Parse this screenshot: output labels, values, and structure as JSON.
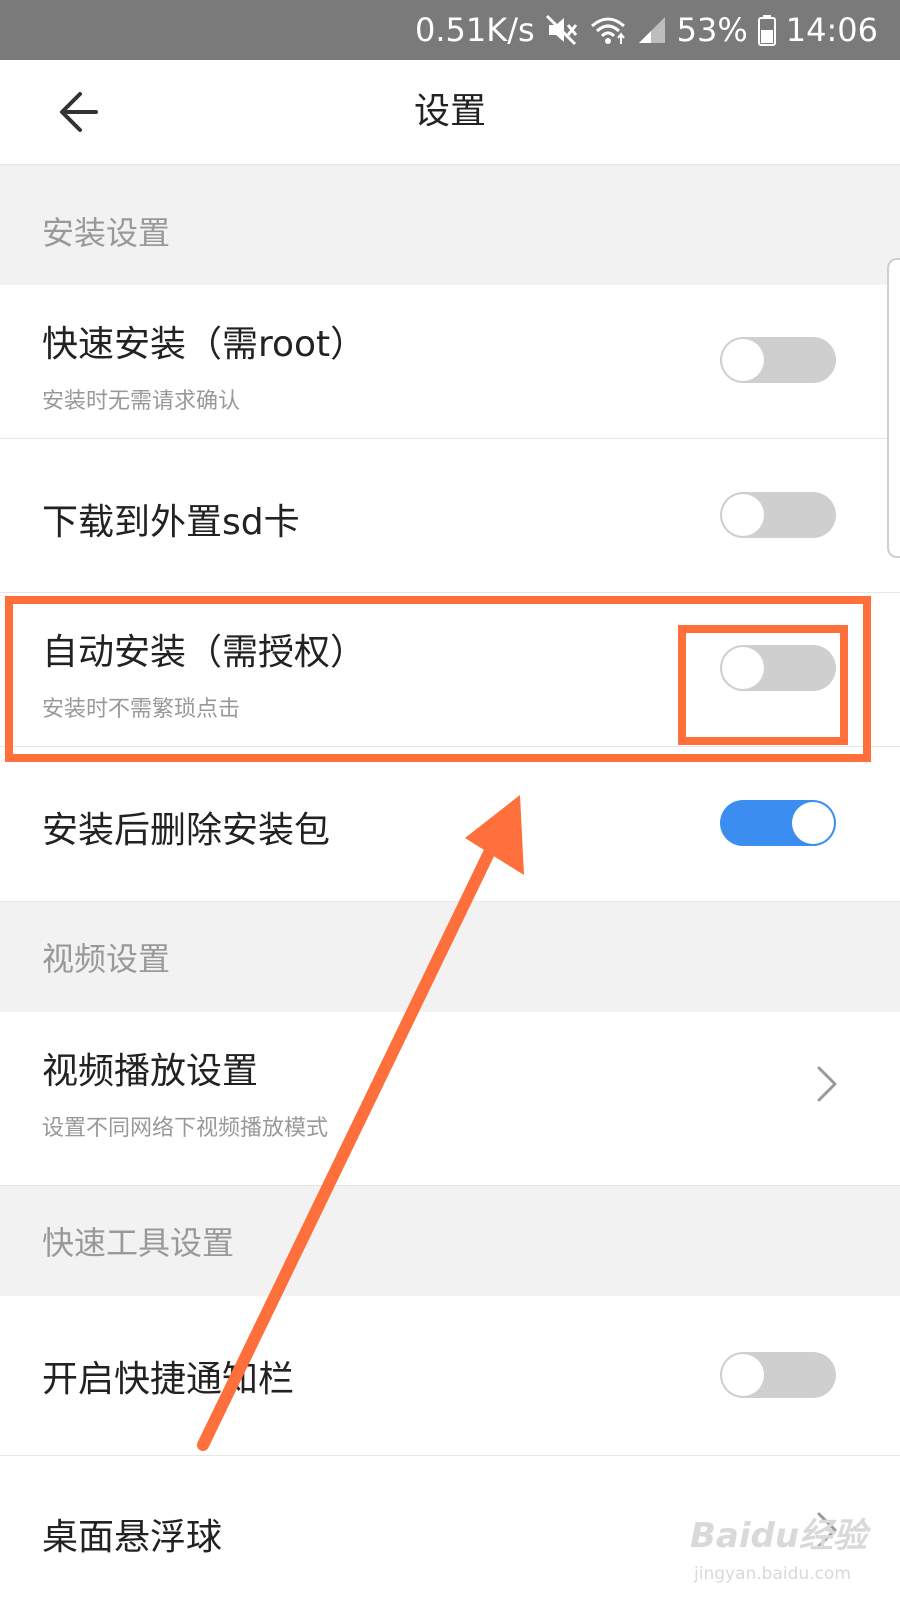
{
  "status_bar": {
    "net_speed": "0.51K/s",
    "battery": "53%",
    "time": "14:06",
    "icons": [
      "mute-icon",
      "wifi-icon",
      "signal-icon",
      "battery-icon"
    ]
  },
  "app_bar": {
    "back_icon": "arrow-left-icon",
    "title": "设置"
  },
  "sections": {
    "install": {
      "header": "安装设置",
      "items": [
        {
          "title": "快速安装（需root）",
          "subtitle": "安装时无需请求确认",
          "control": "toggle",
          "on": false
        },
        {
          "title": "下载到外置sd卡",
          "control": "toggle",
          "on": false
        },
        {
          "title": "自动安装（需授权）",
          "subtitle": "安装时不需繁琐点击",
          "control": "toggle",
          "on": false
        },
        {
          "title": "安装后删除安装包",
          "control": "toggle",
          "on": true
        }
      ]
    },
    "video": {
      "header": "视频设置",
      "items": [
        {
          "title": "视频播放设置",
          "subtitle": "设置不同网络下视频播放模式",
          "control": "chevron"
        }
      ]
    },
    "quick_tools": {
      "header": "快速工具设置",
      "items": [
        {
          "title": "开启快捷通知栏",
          "control": "toggle",
          "on": false
        },
        {
          "title": "桌面悬浮球",
          "control": "chevron"
        }
      ]
    }
  },
  "annotation": {
    "color": "#ff6f3c",
    "highlight_target": "自动安装（需授权）"
  },
  "watermark": {
    "brand": "Baidu经验",
    "url": "jingyan.baidu.com"
  },
  "colors": {
    "toggle_on": "#3b8ef0",
    "toggle_off": "#cfcfcf",
    "section_bg": "#f2f2f2",
    "status_bar": "#7a7a7a"
  }
}
